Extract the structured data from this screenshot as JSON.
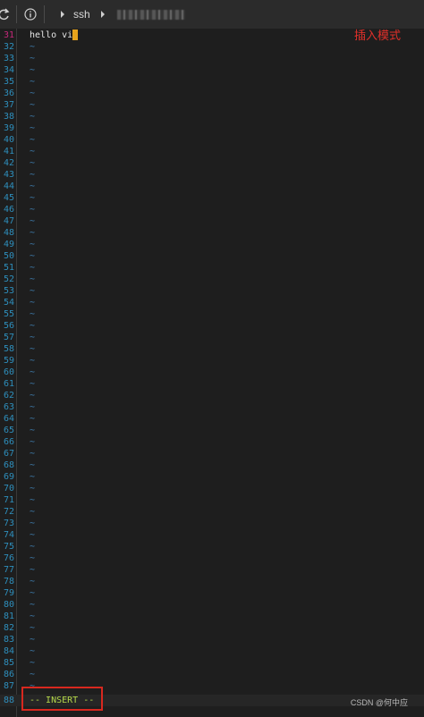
{
  "toolbar": {
    "breadcrumb_label": "ssh"
  },
  "editor": {
    "first_line_text": "hello vi",
    "current_line": "31",
    "line_numbers": [
      "31",
      "32",
      "33",
      "34",
      "35",
      "36",
      "37",
      "38",
      "39",
      "40",
      "41",
      "42",
      "43",
      "44",
      "45",
      "46",
      "47",
      "48",
      "49",
      "50",
      "51",
      "52",
      "53",
      "54",
      "55",
      "56",
      "57",
      "58",
      "59",
      "60",
      "61",
      "62",
      "63",
      "64",
      "65",
      "66",
      "67",
      "68",
      "69",
      "70",
      "71",
      "72",
      "73",
      "74",
      "75",
      "76",
      "77",
      "78",
      "79",
      "80",
      "81",
      "82",
      "83",
      "84",
      "85",
      "86",
      "87",
      "88"
    ],
    "empty_line_marker": "~",
    "mode_indicator": "-- INSERT --"
  },
  "annotation": {
    "label": "插入模式"
  },
  "watermark": "CSDN @何中应",
  "colors": {
    "background": "#1e1e1e",
    "line_number": "#2e8fbd",
    "current_line_number": "#c5287a",
    "cursor": "#e6a31c",
    "mode_text": "#b5d84a",
    "annotation": "#e0302a"
  }
}
